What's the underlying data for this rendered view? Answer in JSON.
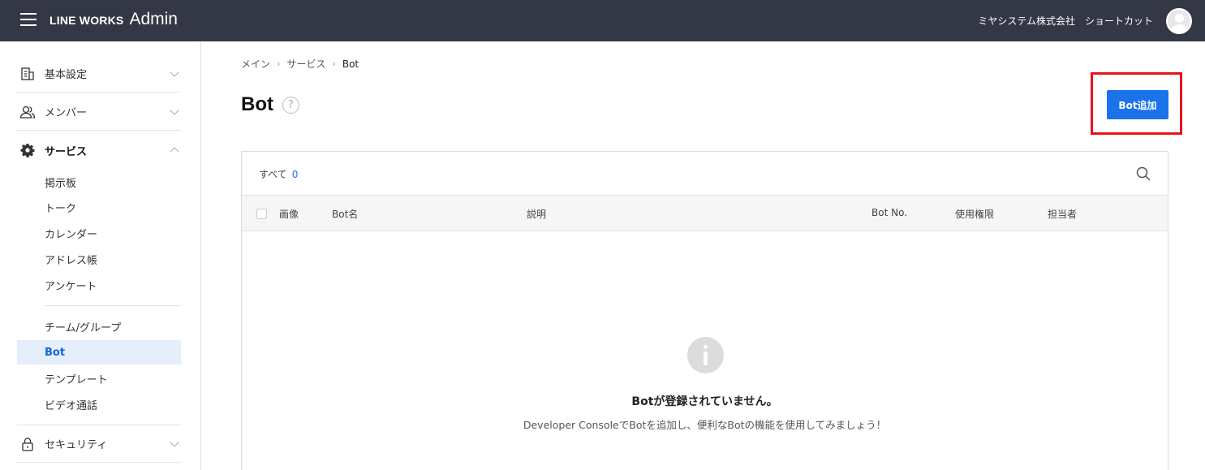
{
  "header": {
    "brand_main": "LINE WORKS",
    "brand_sub": "Admin",
    "company": "ミヤシステム株式会社",
    "shortcut": "ショートカット"
  },
  "sidebar": {
    "groups": [
      {
        "label": "基本設定",
        "icon": "building-icon",
        "expanded": false
      },
      {
        "label": "メンバー",
        "icon": "members-icon",
        "expanded": false
      },
      {
        "label": "サービス",
        "icon": "gear-icon",
        "expanded": true
      },
      {
        "label": "セキュリティ",
        "icon": "lock-icon",
        "expanded": false
      }
    ],
    "service_items": [
      "掲示板",
      "トーク",
      "カレンダー",
      "アドレス帳",
      "アンケート"
    ],
    "service_items_2": [
      "チーム/グループ",
      "Bot",
      "テンプレート",
      "ビデオ通話"
    ],
    "active_item": "Bot"
  },
  "breadcrumb": [
    "メイン",
    "サービス",
    "Bot"
  ],
  "page": {
    "title": "Bot",
    "help": "?",
    "add_button": "Bot追加"
  },
  "panel": {
    "filter_label": "すべて",
    "filter_count": "0",
    "columns": [
      "画像",
      "Bot名",
      "説明",
      "Bot No.",
      "使用権限",
      "担当者"
    ],
    "empty_title": "Botが登録されていません。",
    "empty_desc": "Developer ConsoleでBotを追加し、便利なBotの機能を使用してみましょう！"
  },
  "colors": {
    "topbar": "#343746",
    "accent": "#1a73e8",
    "highlight": "#e5141a",
    "active_bg": "#e5eefb"
  }
}
